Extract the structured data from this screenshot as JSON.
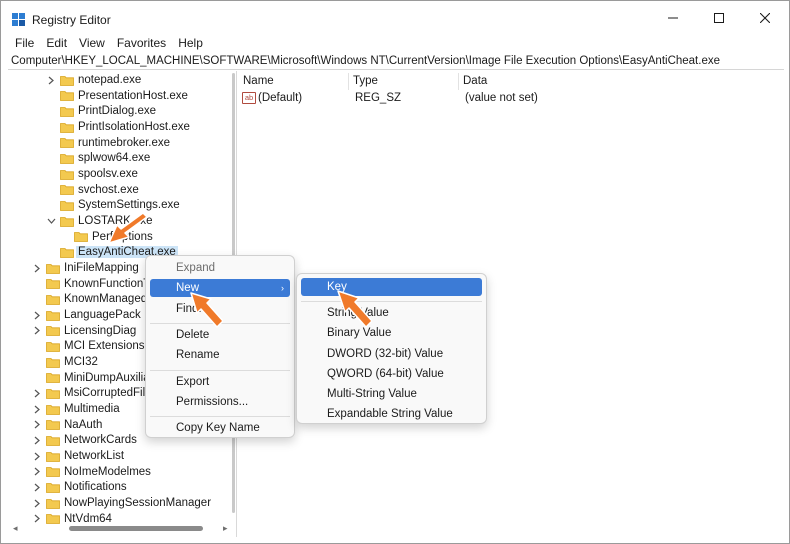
{
  "window": {
    "title": "Registry Editor",
    "controls": {
      "minimize": "minimize",
      "maximize": "maximize",
      "close": "close"
    }
  },
  "menubar": [
    "File",
    "Edit",
    "View",
    "Favorites",
    "Help"
  ],
  "address": "Computer\\HKEY_LOCAL_MACHINE\\SOFTWARE\\Microsoft\\Windows NT\\CurrentVersion\\Image File Execution Options\\EasyAntiCheat.exe",
  "tree": [
    {
      "label": "notepad.exe",
      "level": 2,
      "expander": "collapsed"
    },
    {
      "label": "PresentationHost.exe",
      "level": 2,
      "expander": "none"
    },
    {
      "label": "PrintDialog.exe",
      "level": 2,
      "expander": "none"
    },
    {
      "label": "PrintIsolationHost.exe",
      "level": 2,
      "expander": "none"
    },
    {
      "label": "runtimebroker.exe",
      "level": 2,
      "expander": "none"
    },
    {
      "label": "splwow64.exe",
      "level": 2,
      "expander": "none"
    },
    {
      "label": "spoolsv.exe",
      "level": 2,
      "expander": "none"
    },
    {
      "label": "svchost.exe",
      "level": 2,
      "expander": "none"
    },
    {
      "label": "SystemSettings.exe",
      "level": 2,
      "expander": "none"
    },
    {
      "label": "LOSTARK.exe",
      "level": 2,
      "expander": "expanded"
    },
    {
      "label": "PerfOptions",
      "level": 3,
      "expander": "none"
    },
    {
      "label": "EasyAntiCheat.exe",
      "level": 2,
      "expander": "none",
      "selected": true
    },
    {
      "label": "IniFileMapping",
      "level": 1,
      "expander": "collapsed"
    },
    {
      "label": "KnownFunctionTableDlls",
      "level": 1,
      "expander": "none"
    },
    {
      "label": "KnownManagedDebuggingDlls",
      "level": 1,
      "expander": "none"
    },
    {
      "label": "LanguagePack",
      "level": 1,
      "expander": "collapsed"
    },
    {
      "label": "LicensingDiag",
      "level": 1,
      "expander": "collapsed"
    },
    {
      "label": "MCI Extensions",
      "level": 1,
      "expander": "none"
    },
    {
      "label": "MCI32",
      "level": 1,
      "expander": "none"
    },
    {
      "label": "MiniDumpAuxiliaryDlls",
      "level": 1,
      "expander": "none"
    },
    {
      "label": "MsiCorruptedFileRecovery",
      "level": 1,
      "expander": "collapsed"
    },
    {
      "label": "Multimedia",
      "level": 1,
      "expander": "collapsed"
    },
    {
      "label": "NaAuth",
      "level": 1,
      "expander": "collapsed"
    },
    {
      "label": "NetworkCards",
      "level": 1,
      "expander": "collapsed"
    },
    {
      "label": "NetworkList",
      "level": 1,
      "expander": "collapsed"
    },
    {
      "label": "NoImeModelmes",
      "level": 1,
      "expander": "collapsed"
    },
    {
      "label": "Notifications",
      "level": 1,
      "expander": "collapsed"
    },
    {
      "label": "NowPlayingSessionManager",
      "level": 1,
      "expander": "collapsed"
    },
    {
      "label": "NtVdm64",
      "level": 1,
      "expander": "collapsed"
    }
  ],
  "values": {
    "headers": {
      "name": "Name",
      "type": "Type",
      "data": "Data"
    },
    "rows": [
      {
        "icon": "string-value-icon",
        "icon_text": "ab",
        "name": "(Default)",
        "type": "REG_SZ",
        "data": "(value not set)"
      }
    ]
  },
  "context_menu": {
    "items": [
      {
        "label": "Expand",
        "disabled": true
      },
      {
        "label": "New",
        "submenu": true,
        "highlighted": true
      },
      {
        "label": "Find..."
      },
      {
        "separator": true
      },
      {
        "label": "Delete"
      },
      {
        "label": "Rename"
      },
      {
        "separator": true
      },
      {
        "label": "Export"
      },
      {
        "label": "Permissions..."
      },
      {
        "separator": true
      },
      {
        "label": "Copy Key Name"
      }
    ]
  },
  "new_submenu": {
    "items": [
      {
        "label": "Key",
        "highlighted": true
      },
      {
        "separator": true
      },
      {
        "label": "String Value"
      },
      {
        "label": "Binary Value"
      },
      {
        "label": "DWORD (32-bit) Value"
      },
      {
        "label": "QWORD (64-bit) Value"
      },
      {
        "label": "Multi-String Value"
      },
      {
        "label": "Expandable String Value"
      }
    ]
  },
  "colors": {
    "highlight": "#3c7bd6",
    "selection": "#cce4f7",
    "pointer": "#f07a2a",
    "folder": "#f3c94f"
  }
}
